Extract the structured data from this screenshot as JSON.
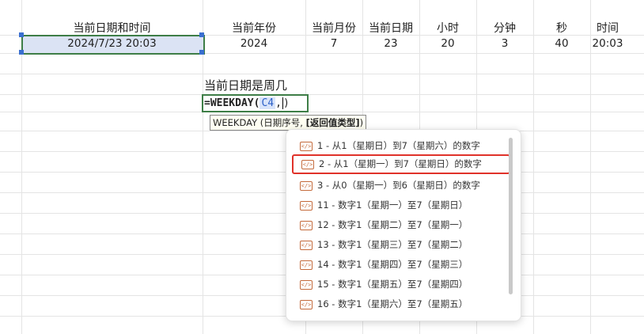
{
  "headers": [
    "当前日期和时间",
    "当前年份",
    "当前月份",
    "当前日期",
    "小时",
    "分钟",
    "秒",
    "时间"
  ],
  "values": [
    "2024/7/23 20:03",
    "2024",
    "7",
    "23",
    "20",
    "3",
    "40",
    "20:03"
  ],
  "label_cell": "当前日期是周几",
  "formula": {
    "prefix": "=WEEKDAY(",
    "ref": "C4",
    "sep": ",",
    "close": ")"
  },
  "tooltip": {
    "text": "WEEKDAY (日期序号, ",
    "bold": "[返回值类型]",
    "end": ")"
  },
  "options": [
    "1 - 从1（星期日）到7（星期六）的数字",
    "2 - 从1（星期一）到7（星期日）的数字",
    "3 - 从0（星期一）到6（星期日）的数字",
    "11 - 数字1（星期一）至7（星期日）",
    "12 - 数字1（星期二）至7（星期一）",
    "13 - 数字1（星期三）至7（星期二）",
    "14 - 数字1（星期四）至7（星期三）",
    "15 - 数字1（星期五）至7（星期四）",
    "16 - 数字1（星期六）至7（星期五）"
  ],
  "highlighted_option": "2 - 从1（星期一）到7（星期日）的数字",
  "option_icon": "function-icon",
  "colors": {
    "selection_border": "#3e7e47",
    "selection_fill": "#dbe3f4",
    "highlight_border": "#e0322a"
  }
}
